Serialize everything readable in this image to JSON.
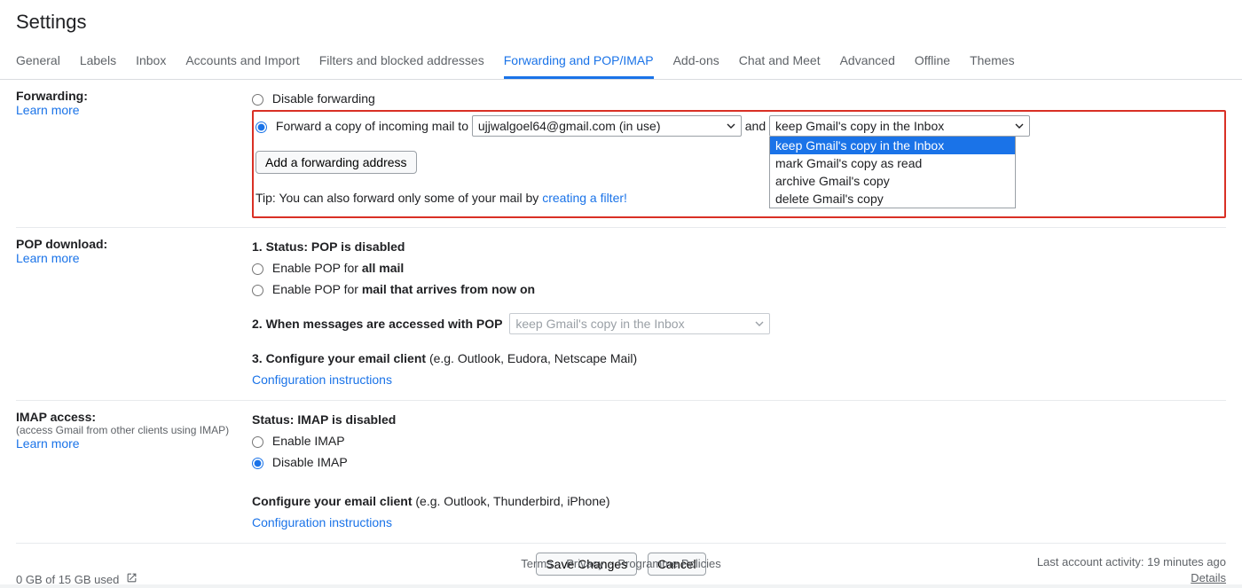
{
  "title": "Settings",
  "tabs": [
    "General",
    "Labels",
    "Inbox",
    "Accounts and Import",
    "Filters and blocked addresses",
    "Forwarding and POP/IMAP",
    "Add-ons",
    "Chat and Meet",
    "Advanced",
    "Offline",
    "Themes"
  ],
  "active_tab_index": 5,
  "forwarding": {
    "heading": "Forwarding:",
    "learn_more": "Learn more",
    "disable_label": "Disable forwarding",
    "forward_label_prefix": "Forward a copy of incoming mail to ",
    "forward_and": " and ",
    "address_select": "ujjwalgoel64@gmail.com (in use)",
    "copy_select": "keep Gmail's copy in the Inbox",
    "copy_options": [
      "keep Gmail's copy in the Inbox",
      "mark Gmail's copy as read",
      "archive Gmail's copy",
      "delete Gmail's copy"
    ],
    "add_button": "Add a forwarding address",
    "tip_prefix": "Tip: You can also forward only some of your mail by ",
    "tip_link": "creating a filter!"
  },
  "pop": {
    "heading": "POP download:",
    "learn_more": "Learn more",
    "status_prefix": "1. Status: ",
    "status_value": "POP is disabled",
    "enable_all_prefix": "Enable POP for ",
    "enable_all_bold": "all mail",
    "enable_now_prefix": "Enable POP for ",
    "enable_now_bold": "mail that arrives from now on",
    "when_accessed": "2. When messages are accessed with POP",
    "when_select": "keep Gmail's copy in the Inbox",
    "configure_bold": "3. Configure your email client ",
    "configure_rest": "(e.g. Outlook, Eudora, Netscape Mail)",
    "config_link": "Configuration instructions"
  },
  "imap": {
    "heading": "IMAP access:",
    "subnote": "(access Gmail from other clients using IMAP)",
    "learn_more": "Learn more",
    "status_prefix": "Status: ",
    "status_value": "IMAP is disabled",
    "enable_label": "Enable IMAP",
    "disable_label": "Disable IMAP",
    "configure_bold": "Configure your email client ",
    "configure_rest": "(e.g. Outlook, Thunderbird, iPhone)",
    "config_link": "Configuration instructions"
  },
  "buttons": {
    "save": "Save Changes",
    "cancel": "Cancel"
  },
  "footer": {
    "storage": "0 GB of 15 GB used",
    "links": [
      "Terms",
      "Privacy",
      "Programme Policies"
    ],
    "activity": "Last account activity: 19 minutes ago",
    "details": "Details"
  }
}
